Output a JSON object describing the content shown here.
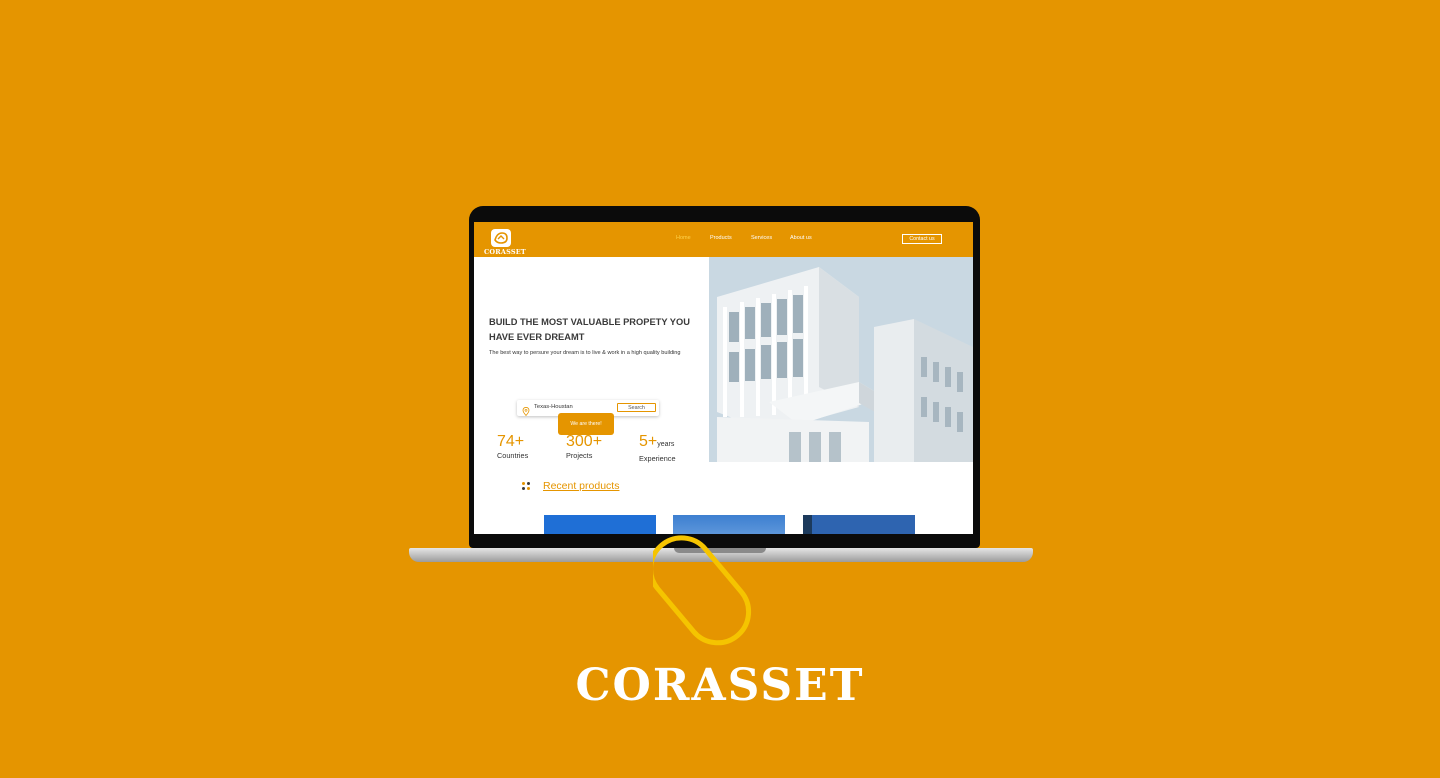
{
  "site": {
    "logo_text": "CORASSET",
    "nav": [
      {
        "label": "Home",
        "active": true
      },
      {
        "label": "Products",
        "active": false
      },
      {
        "label": "Services",
        "active": false
      },
      {
        "label": "About us",
        "active": false
      }
    ],
    "contact_label": "Contact us"
  },
  "hero": {
    "title": "BUILD THE MOST VALUABLE PROPETY YOU HAVE EVER DREAMT",
    "subtitle": "The best way to persure your dream is to live & work in a high quality building",
    "search_value": "Texas-Houstan",
    "search_button": "Search",
    "tooltip": "We are there!",
    "image_alt": "white modern building"
  },
  "stats": [
    {
      "value": "74+",
      "suffix": "",
      "label": "Countries"
    },
    {
      "value": "300+",
      "suffix": "",
      "label": "Projects"
    },
    {
      "value": "5+",
      "suffix": "years",
      "label": "Experience"
    }
  ],
  "recent": {
    "label": "Recent products"
  },
  "brand": {
    "name": "CORASSET"
  },
  "colors": {
    "accent": "#E59500",
    "ring": "#F5C400",
    "text": "#333333"
  },
  "icons": [
    "pin-icon",
    "dots-icon",
    "logo-icon"
  ]
}
